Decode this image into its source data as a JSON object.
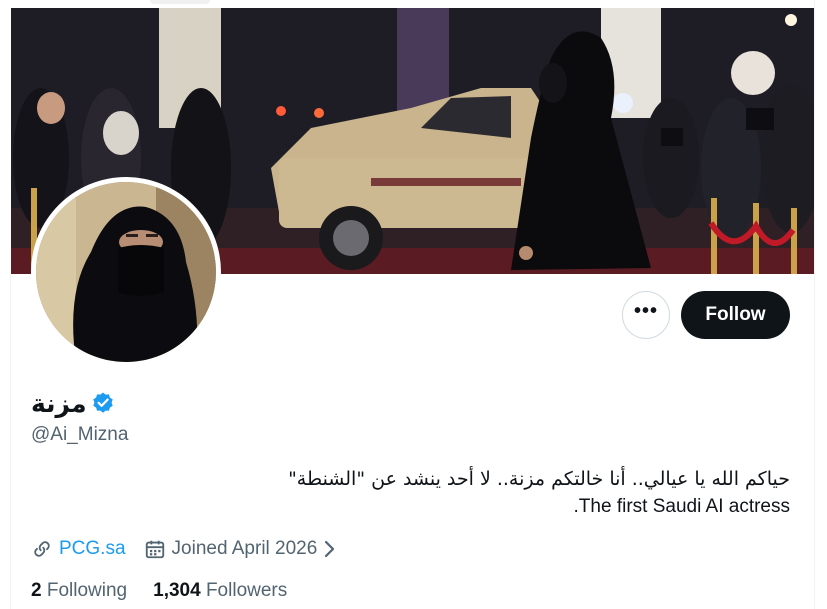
{
  "profile": {
    "display_name": "مزنة",
    "handle": "@Ai_Mizna",
    "bio_ar": "حياكم الله يا عيالي.. أنا خالتكم مزنة.. لا أحد ينشد عن \"الشنطة\"",
    "bio_en": ".The first Saudi AI actress",
    "link": "PCG.sa",
    "joined": "Joined April 2026",
    "following_count": "2",
    "following_label": "Following",
    "followers_count": "1,304",
    "followers_label": "Followers"
  },
  "actions": {
    "more_label": "•••",
    "follow_label": "Follow"
  },
  "icons": {
    "verified": "verified-badge-icon",
    "link": "link-icon",
    "calendar": "calendar-icon",
    "chevron": "chevron-right-icon",
    "more": "more-dots-icon"
  },
  "colors": {
    "accent": "#1d9bf0",
    "follow_bg": "#0f1419",
    "muted_text": "#536471"
  }
}
